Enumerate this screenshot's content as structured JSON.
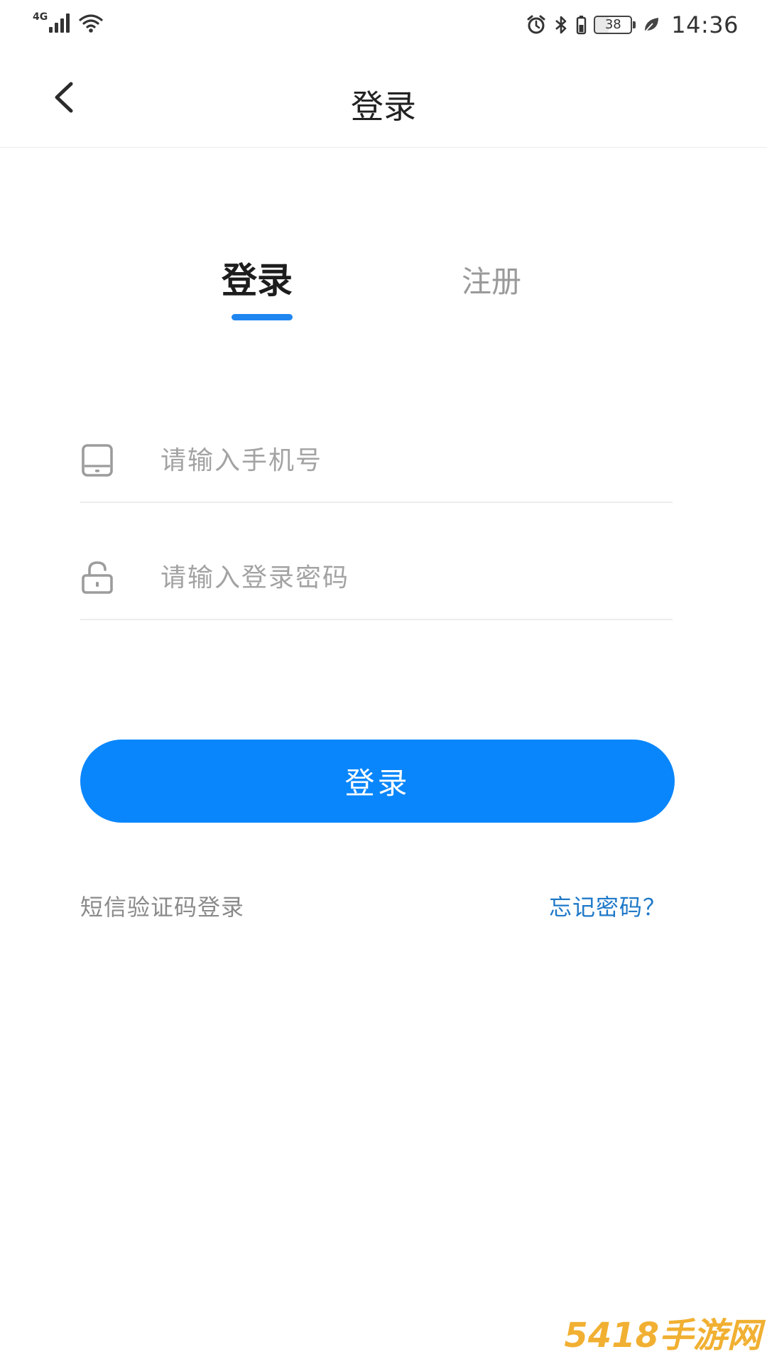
{
  "status_bar": {
    "network": "4G",
    "battery_level": "38",
    "time": "14:36"
  },
  "nav": {
    "title": "登录",
    "back_icon": "chevron-left-icon"
  },
  "tabs": {
    "login": "登录",
    "register": "注册",
    "active": "login"
  },
  "form": {
    "phone_placeholder": "请输入手机号",
    "phone_icon": "phone-icon",
    "password_placeholder": "请输入登录密码",
    "password_icon": "lock-icon",
    "submit_label": "登录"
  },
  "links": {
    "sms_login": "短信验证码登录",
    "forgot_password": "忘记密码？"
  },
  "watermark": "5418手游网",
  "colors": {
    "accent": "#0986fb",
    "tab_indicator": "#1f86f0",
    "link": "#1f79c8"
  }
}
